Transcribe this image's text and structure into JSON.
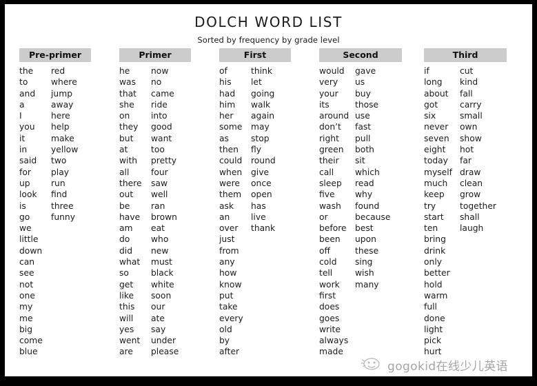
{
  "document": {
    "title": "DOLCH WORD LIST",
    "subtitle": "Sorted by frequency by grade level",
    "border_color": "#000000",
    "page_color": "#ffffff",
    "header_bar_color": "#cccccc",
    "text_color": "#1b1b1b"
  },
  "watermark": {
    "icon": "smiley-face-icon",
    "text": "gogokid在线少儿英语"
  },
  "columns": [
    {
      "header": "Pre-primer",
      "sub_a": [
        "the",
        "to",
        "and",
        "a",
        "I",
        "you",
        "it",
        "in",
        "said",
        "for",
        "up",
        "look",
        "is",
        "go",
        "we",
        "little",
        "down",
        "can",
        "see",
        "not",
        "one",
        "my",
        "me",
        "big",
        "come",
        "blue"
      ],
      "sub_b": [
        "red",
        "where",
        "jump",
        "away",
        "here",
        "help",
        "make",
        "yellow",
        "two",
        "play",
        "run",
        "find",
        "three",
        "funny"
      ]
    },
    {
      "header": "Primer",
      "sub_a": [
        "he",
        "was",
        "that",
        "she",
        "on",
        "they",
        "but",
        "at",
        "with",
        "all",
        "there",
        "out",
        "be",
        "have",
        "am",
        "do",
        "did",
        "what",
        "so",
        "get",
        "like",
        "this",
        "will",
        "yes",
        "went",
        "are"
      ],
      "sub_b": [
        "now",
        "no",
        "came",
        "ride",
        "into",
        "good",
        "want",
        "too",
        "pretty",
        "four",
        "saw",
        "well",
        "ran",
        "brown",
        "eat",
        "who",
        "new",
        "must",
        "black",
        "white",
        "soon",
        "our",
        "ate",
        "say",
        "under",
        "please"
      ]
    },
    {
      "header": "First",
      "sub_a": [
        "of",
        "his",
        "had",
        "him",
        "her",
        "some",
        "as",
        "then",
        "could",
        "when",
        "were",
        "them",
        "ask",
        "an",
        "over",
        "just",
        "from",
        "any",
        "how",
        "know",
        "put",
        "take",
        "every",
        "old",
        "by",
        "after"
      ],
      "sub_b": [
        "think",
        "let",
        "going",
        "walk",
        "again",
        "may",
        "stop",
        "fly",
        "round",
        "give",
        "once",
        "open",
        "has",
        "live",
        "thank"
      ]
    },
    {
      "header": "Second",
      "sub_a": [
        "would",
        "very",
        "your",
        "its",
        "around",
        "don’t",
        "right",
        "green",
        "their",
        "call",
        "sleep",
        "five",
        "wash",
        "or",
        "before",
        "been",
        "off",
        "cold",
        "tell",
        "work",
        "first",
        "does",
        "goes",
        "write",
        "always",
        "made"
      ],
      "sub_b": [
        "gave",
        "us",
        "buy",
        "those",
        "use",
        "fast",
        "pull",
        "both",
        "sit",
        "which",
        "read",
        "why",
        "found",
        "because",
        "best",
        "upon",
        "these",
        "sing",
        "wish",
        "many"
      ]
    },
    {
      "header": "Third",
      "sub_a": [
        "if",
        "long",
        "about",
        "got",
        "six",
        "never",
        "seven",
        "eight",
        "today",
        "myself",
        "much",
        "keep",
        "try",
        "start",
        "ten",
        "bring",
        "drink",
        "only",
        "better",
        "hold",
        "warm",
        "full",
        "done",
        "light",
        "pick",
        "hurt"
      ],
      "sub_b": [
        "cut",
        "kind",
        "fall",
        "carry",
        "small",
        "own",
        "show",
        "hot",
        "far",
        "draw",
        "clean",
        "grow",
        "together",
        "shall",
        "laugh"
      ]
    }
  ]
}
